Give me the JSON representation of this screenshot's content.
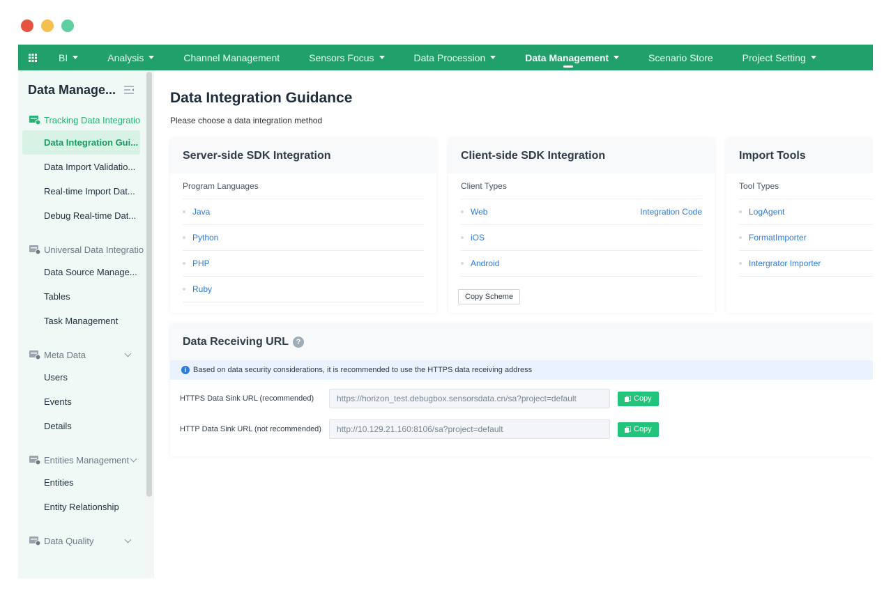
{
  "window": {
    "traffic_colors": [
      "#e5523f",
      "#f4bf4f",
      "#5ecf9e"
    ]
  },
  "topnav": {
    "items": [
      {
        "label": "BI",
        "caret": true
      },
      {
        "label": "Analysis",
        "caret": true
      },
      {
        "label": "Channel Management",
        "caret": false
      },
      {
        "label": "Sensors Focus",
        "caret": true
      },
      {
        "label": "Data Procession",
        "caret": true
      },
      {
        "label": "Data Management",
        "caret": true,
        "active": true
      },
      {
        "label": "Scenario Store",
        "caret": false
      },
      {
        "label": "Project Setting",
        "caret": true
      }
    ],
    "color": "#22a06b"
  },
  "sidebar": {
    "title": "Data Manage...",
    "groups": [
      {
        "label": "Tracking Data Integratio",
        "active": true,
        "items": [
          "Data Integration Gui...",
          "Data Import Validatio...",
          "Real-time Import Dat...",
          "Debug Real-time Dat..."
        ]
      },
      {
        "label": "Universal Data Integratio",
        "items": [
          "Data Source Manage...",
          "Tables",
          "Task Management"
        ]
      },
      {
        "label": "Meta Data",
        "chevron": true,
        "items": [
          "Users",
          "Events",
          "Details"
        ]
      },
      {
        "label": "Entities Management",
        "chevron": true,
        "items": [
          "Entities",
          "Entity Relationship"
        ]
      },
      {
        "label": "Data Quality",
        "chevron": true,
        "items": []
      }
    ]
  },
  "main": {
    "title": "Data Integration Guidance",
    "subtitle": "Please choose a data integration method",
    "cards": [
      {
        "title": "Server-side SDK Integration",
        "label": "Program Languages",
        "rows": [
          {
            "text": "Java"
          },
          {
            "text": "Python"
          },
          {
            "text": "PHP"
          },
          {
            "text": "Ruby"
          }
        ]
      },
      {
        "title": "Client-side SDK Integration",
        "label": "Client Types",
        "rows": [
          {
            "text": "Web",
            "right": "Integration Code"
          },
          {
            "text": "iOS"
          },
          {
            "text": "Android"
          }
        ],
        "button": "Copy Scheme"
      },
      {
        "title": "Import Tools",
        "label": "Tool Types",
        "rows": [
          {
            "text": "LogAgent"
          },
          {
            "text": "FormatImporter"
          },
          {
            "text": "Intergrator Importer"
          }
        ]
      }
    ],
    "receiving": {
      "title": "Data Receiving URL",
      "notice": "Based on data security considerations, it is recommended to use the HTTPS data receiving address",
      "rows": [
        {
          "label": "HTTPS Data Sink URL (recommended)",
          "value": "https://horizon_test.debugbox.sensorsdata.cn/sa?project=default",
          "button": "Copy"
        },
        {
          "label": "HTTP Data Sink URL (not recommended)",
          "value": "http://10.129.21.160:8106/sa?project=default",
          "button": "Copy"
        }
      ]
    }
  }
}
